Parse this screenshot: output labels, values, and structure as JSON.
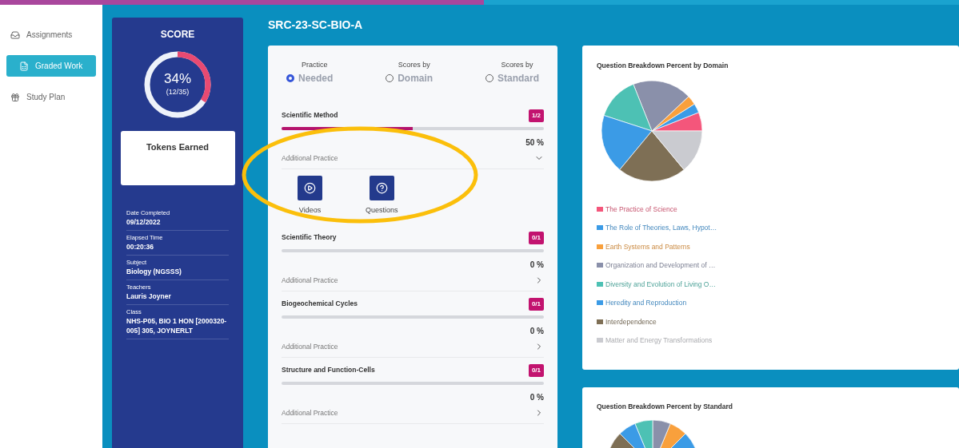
{
  "top_progress": {
    "level": 0.505
  },
  "sidebar": {
    "items": [
      {
        "label": "Assignments",
        "kind": "tray",
        "selected": false
      },
      {
        "label": "Graded Work",
        "kind": "sheet",
        "selected": true
      },
      {
        "label": "Study Plan",
        "kind": "gift",
        "selected": false
      }
    ]
  },
  "score_panel": {
    "title": "SCORE",
    "percent": "34%",
    "fraction": "(12/35)",
    "level": 0.34,
    "tokens_title": "Tokens Earned",
    "details": [
      {
        "label": "Date Completed",
        "value": "09/12/2022"
      },
      {
        "label": "Elapsed Time",
        "value": "00:20:36"
      },
      {
        "label": "Subject",
        "value": "Biology (NGSSS)"
      },
      {
        "label": "Teachers",
        "value": "Lauris Joyner"
      },
      {
        "label": "Class",
        "value": "NHS-P05, BIO 1 HON [2000320-005] 305, JOYNERLT"
      }
    ]
  },
  "page_title": "SRC-23-SC-BIO-A",
  "view_options": [
    {
      "top": "Practice",
      "label": "Needed",
      "selected": true
    },
    {
      "top": "Scores by",
      "label": "Domain",
      "selected": false
    },
    {
      "top": "Scores by",
      "label": "Standard",
      "selected": false
    }
  ],
  "sections": [
    {
      "name": "Scientific Method",
      "badge": "1/2",
      "level": 0.5,
      "percent": "50 %",
      "practice_label": "Additional Practice",
      "expanded": true,
      "options": [
        {
          "label": "Videos",
          "kind": "video"
        },
        {
          "label": "Questions",
          "kind": "question"
        }
      ]
    },
    {
      "name": "Scientific Theory",
      "badge": "0/1",
      "level": 0,
      "percent": "0 %",
      "practice_label": "Additional Practice",
      "expanded": false
    },
    {
      "name": "Biogeochemical Cycles",
      "badge": "0/1",
      "level": 0,
      "percent": "0 %",
      "practice_label": "Additional Practice",
      "expanded": false
    },
    {
      "name": "Structure and Function-Cells",
      "badge": "0/1",
      "level": 0,
      "percent": "0 %",
      "practice_label": "Additional Practice",
      "expanded": false
    }
  ],
  "domain_chart": {
    "title": "Question Breakdown Percent by Domain",
    "legend": [
      {
        "label": "The Practice of Science",
        "color": "#f4567b"
      },
      {
        "label": "The Role of Theories, Laws, Hypot…",
        "color": "#3b9be6"
      },
      {
        "label": "Earth Systems and Patterns",
        "color": "#f9a03c"
      },
      {
        "label": "Organization and Development of …",
        "color": "#8a90aa"
      },
      {
        "label": "Diversity and Evolution of Living O…",
        "color": "#4dc1b4"
      },
      {
        "label": "Heredity and Reproduction",
        "color": "#3b9be6"
      },
      {
        "label": "Interdependence",
        "color": "#7e6f55"
      },
      {
        "label": "Matter and Energy Transformations",
        "color": "#cacbd0"
      }
    ]
  },
  "standard_chart": {
    "title": "Question Breakdown Percent by Standard"
  }
}
